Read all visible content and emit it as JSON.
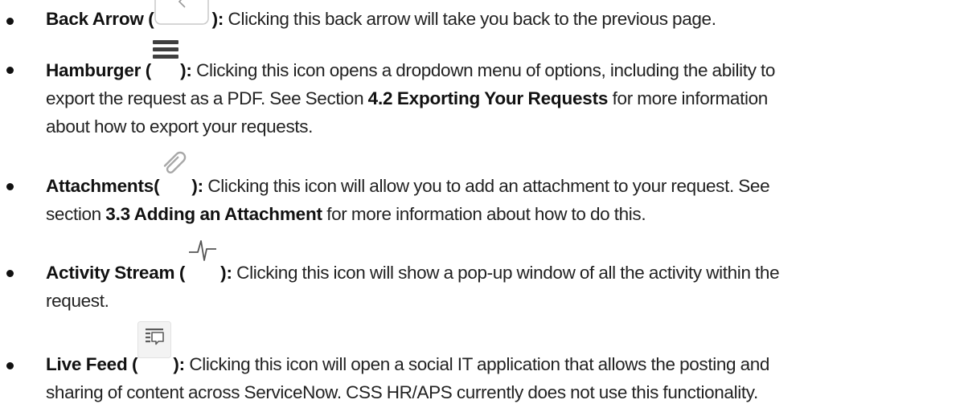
{
  "items": [
    {
      "term": "Back Arrow (",
      "term_close": "):",
      "icon": "back-arrow-icon",
      "line1": " Clicking this back arrow will take you back to the previous page."
    },
    {
      "term": "Hamburger (",
      "term_close": "):",
      "icon": "hamburger-menu-icon",
      "line1": " Clicking this icon opens a dropdown menu of options, including the ability to",
      "line2_pre": "export the request as a PDF. See Section ",
      "line2_ref": "4.2 Exporting Your Requests",
      "line2_post": " for more information",
      "line3": "about how to export your requests."
    },
    {
      "term": "Attachments(",
      "term_close": "):",
      "icon": "paperclip-icon",
      "line1": " Clicking this icon will allow you to add an attachment to your request. See",
      "line2_pre": "section ",
      "line2_ref": "3.3 Adding an Attachment",
      "line2_post": " for more information about how to do this."
    },
    {
      "term": "Activity Stream (",
      "term_close": "):",
      "icon": "activity-pulse-icon",
      "line1": " Clicking this icon will show a pop-up window of all the activity within the",
      "line2": "request."
    },
    {
      "term": "Live Feed (",
      "term_close": "):",
      "icon": "live-feed-icon",
      "line1": " Clicking this icon will open a social IT application that allows the posting and",
      "line2": "sharing of content across ServiceNow. CSS HR/APS currently does not use this functionality."
    }
  ]
}
